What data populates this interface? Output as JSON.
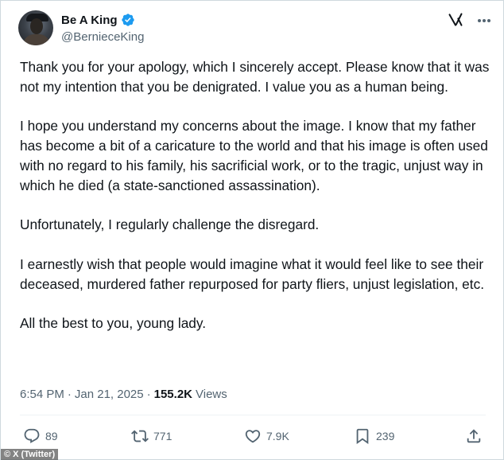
{
  "header": {
    "display_name": "Be A King",
    "handle": "@BernieceKing",
    "verified_color": "#1d9bf0"
  },
  "tweet": {
    "paragraphs": [
      "Thank you for your apology, which I sincerely accept. Please know that it was not my intention that you be denigrated. I value you as a human being.",
      "I hope you understand my concerns about the image. I know that my father has become a bit of a caricature to the world and that his image is often used with no regard to his family, his sacrificial work, or to the tragic, unjust way in which he died (a state-sanctioned assassination).",
      "Unfortunately, I regularly challenge the disregard.",
      "I earnestly wish that people would imagine what it would feel like to see their deceased, murdered father repurposed for party fliers, unjust legislation, etc.",
      "All the best to you, young lady."
    ]
  },
  "meta": {
    "time": "6:54 PM",
    "separator": "·",
    "date": "Jan 21, 2025",
    "views_count": "155.2K",
    "views_label": "Views"
  },
  "actions": {
    "replies": "89",
    "reposts": "771",
    "likes": "7.9K",
    "bookmarks": "239"
  },
  "icons": {
    "reply": "reply-icon",
    "repost": "repost-icon",
    "like": "heart-icon",
    "bookmark": "bookmark-icon",
    "share": "share-icon",
    "logo": "grok-icon",
    "more": "more-icon"
  },
  "watermark": "© X (Twitter)"
}
